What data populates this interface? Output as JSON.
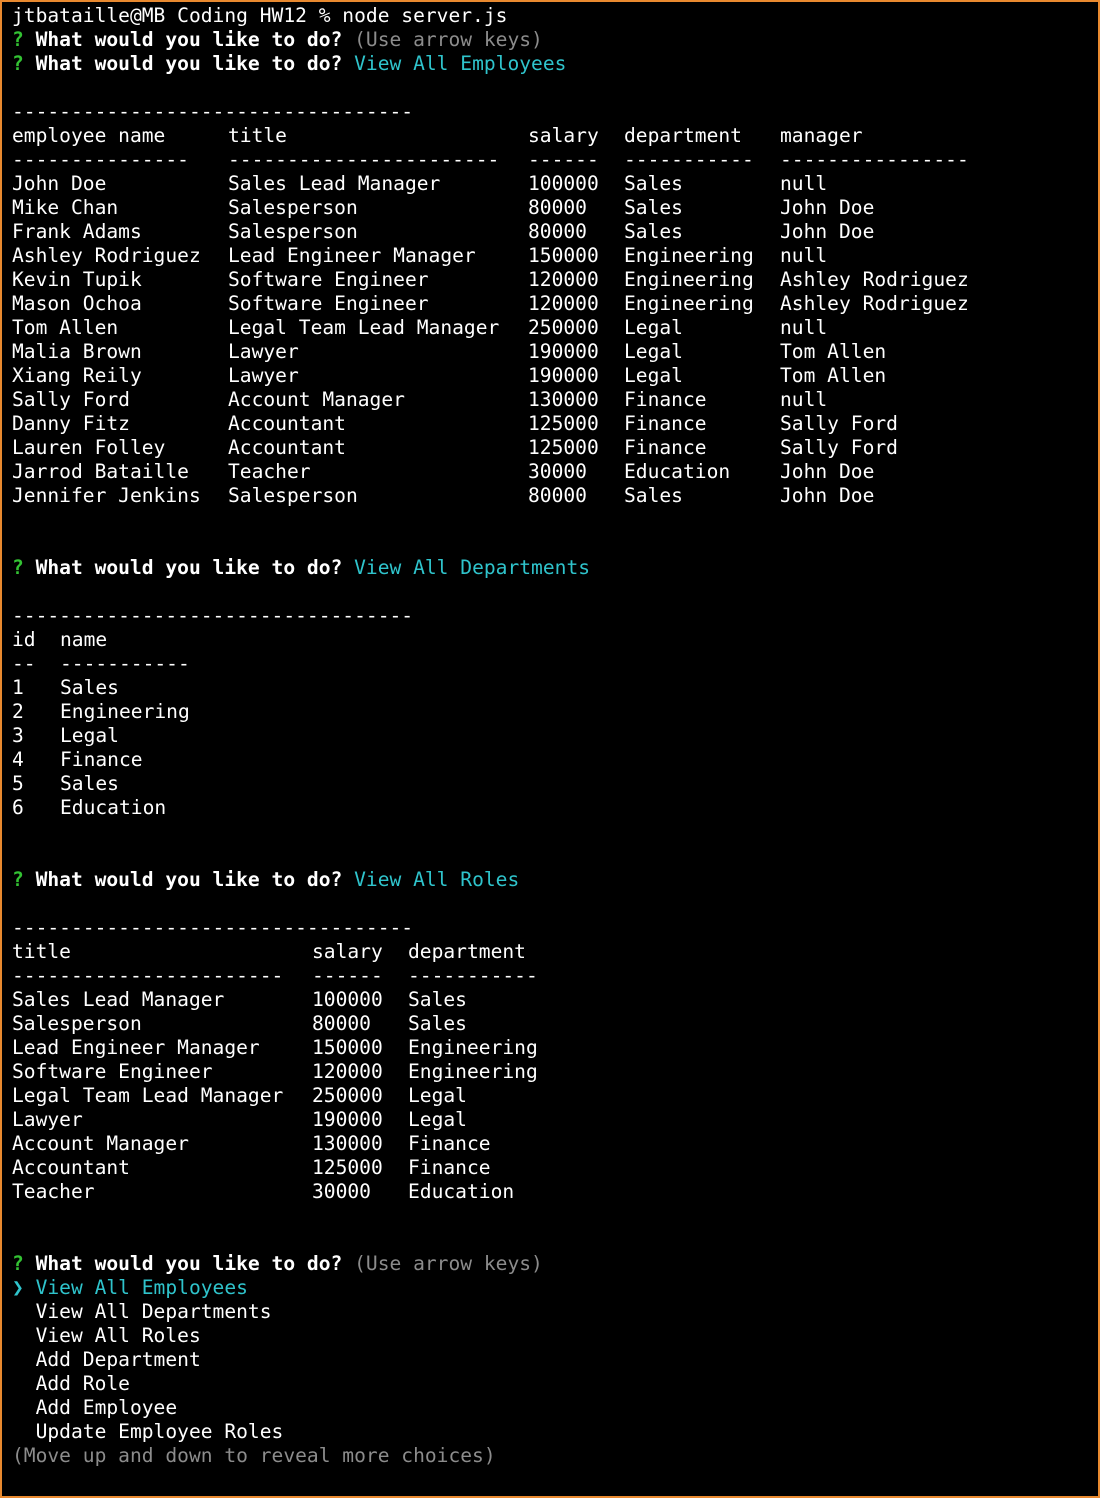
{
  "prompt_line": "jtbataille@MB Coding HW12 % node server.js",
  "question_mark": "?",
  "question": "What would you like to do?",
  "hint": "(Use arrow keys)",
  "separator": "----------------------------------",
  "answers": {
    "employees": "View All Employees",
    "departments": "View All Departments",
    "roles": "View All Roles"
  },
  "employees_table": {
    "headers": [
      "employee name",
      "title",
      "salary",
      "department",
      "manager"
    ],
    "underlines": [
      "---------------",
      "-----------------------",
      "------",
      "-----------",
      "----------------"
    ],
    "rows": [
      [
        "John Doe",
        "Sales Lead Manager",
        "100000",
        "Sales",
        "null"
      ],
      [
        "Mike Chan",
        "Salesperson",
        "80000",
        "Sales",
        "John Doe"
      ],
      [
        "Frank Adams",
        "Salesperson",
        "80000",
        "Sales",
        "John Doe"
      ],
      [
        "Ashley Rodriguez",
        "Lead Engineer Manager",
        "150000",
        "Engineering",
        "null"
      ],
      [
        "Kevin Tupik",
        "Software Engineer",
        "120000",
        "Engineering",
        "Ashley Rodriguez"
      ],
      [
        "Mason Ochoa",
        "Software Engineer",
        "120000",
        "Engineering",
        "Ashley Rodriguez"
      ],
      [
        "Tom Allen",
        "Legal Team Lead Manager",
        "250000",
        "Legal",
        "null"
      ],
      [
        "Malia Brown",
        "Lawyer",
        "190000",
        "Legal",
        "Tom Allen"
      ],
      [
        "Xiang Reily",
        "Lawyer",
        "190000",
        "Legal",
        "Tom Allen"
      ],
      [
        "Sally Ford",
        "Account Manager",
        "130000",
        "Finance",
        "null"
      ],
      [
        "Danny Fitz",
        "Accountant",
        "125000",
        "Finance",
        "Sally Ford"
      ],
      [
        "Lauren Folley",
        "Accountant",
        "125000",
        "Finance",
        "Sally Ford"
      ],
      [
        "Jarrod Bataille",
        "Teacher",
        "30000",
        "Education",
        "John Doe"
      ],
      [
        "Jennifer Jenkins",
        "Salesperson",
        "80000",
        "Sales",
        "John Doe"
      ]
    ]
  },
  "departments_table": {
    "headers": [
      "id",
      "name"
    ],
    "underlines": [
      "--",
      "-----------"
    ],
    "rows": [
      [
        "1",
        "Sales"
      ],
      [
        "2",
        "Engineering"
      ],
      [
        "3",
        "Legal"
      ],
      [
        "4",
        "Finance"
      ],
      [
        "5",
        "Sales"
      ],
      [
        "6",
        "Education"
      ]
    ]
  },
  "roles_table": {
    "headers": [
      "title",
      "salary",
      "department"
    ],
    "underlines": [
      "-----------------------",
      "------",
      "-----------"
    ],
    "rows": [
      [
        "Sales Lead Manager",
        "100000",
        "Sales"
      ],
      [
        "Salesperson",
        "80000",
        "Sales"
      ],
      [
        "Lead Engineer Manager",
        "150000",
        "Engineering"
      ],
      [
        "Software Engineer",
        "120000",
        "Engineering"
      ],
      [
        "Legal Team Lead Manager",
        "250000",
        "Legal"
      ],
      [
        "Lawyer",
        "190000",
        "Legal"
      ],
      [
        "Account Manager",
        "130000",
        "Finance"
      ],
      [
        "Accountant",
        "125000",
        "Finance"
      ],
      [
        "Teacher",
        "30000",
        "Education"
      ]
    ]
  },
  "menu": {
    "pointer": "❯",
    "items": [
      "View All Employees",
      "View All Departments",
      "View All Roles",
      "Add Department",
      "Add Role",
      "Add Employee",
      "Update Employee Roles"
    ],
    "selected_index": 0,
    "footer": "(Move up and down to reveal more choices)"
  },
  "colors": {
    "border": "#e8892f",
    "prompt_mark": "#33c233",
    "answer": "#2fc4cc",
    "hint": "#8c8c8c"
  }
}
